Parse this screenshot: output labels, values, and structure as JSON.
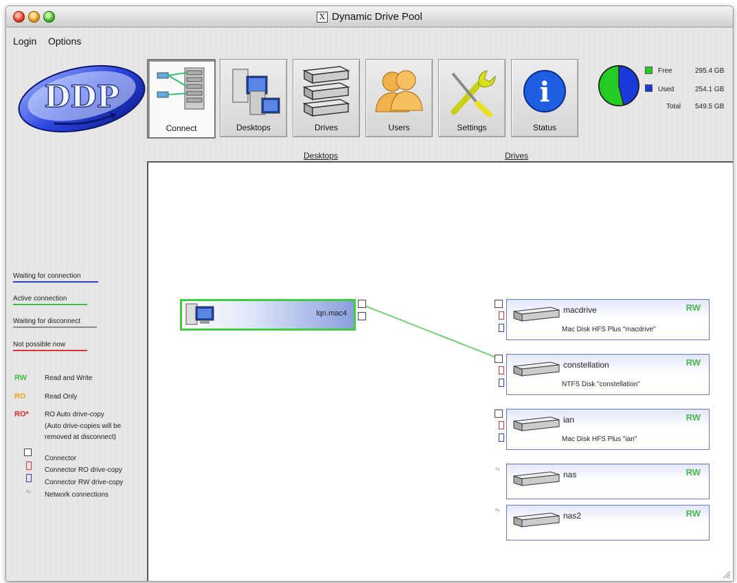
{
  "window": {
    "title": "Dynamic Drive Pool",
    "x_badge": "X"
  },
  "menu": [
    {
      "label": "Login"
    },
    {
      "label": "Options"
    }
  ],
  "logo": {
    "text": "DDP"
  },
  "toolbar": [
    {
      "label": "Connect",
      "active": true
    },
    {
      "label": "Desktops"
    },
    {
      "label": "Drives"
    },
    {
      "label": "Users"
    },
    {
      "label": "Settings"
    },
    {
      "label": "Status"
    }
  ],
  "storage": {
    "free_label": "Free",
    "free_value": "295.4 GB",
    "free_color": "#22cc22",
    "used_label": "Used",
    "used_value": "254.1 GB",
    "used_color": "#1a3adc",
    "total_label": "Total",
    "total_value": "549.5 GB",
    "free_fraction": 0.5376
  },
  "sections": {
    "desktops": "Desktops",
    "drives": "Drives"
  },
  "status_legend": [
    {
      "label": "Waiting for connection",
      "color": "#2a3fd0"
    },
    {
      "label": "Active connection",
      "color": "#39c239"
    },
    {
      "label": "Waiting for disconnect",
      "color": "#777777"
    },
    {
      "label": "Not possible now",
      "color": "#e03030"
    }
  ],
  "access_legend": [
    {
      "tag": "RW",
      "label": "Read and Write",
      "color": "#3fbf3f"
    },
    {
      "tag": "RO",
      "label": "Read Only",
      "color": "#f0a020"
    },
    {
      "tag": "RO*",
      "label": "RO Auto drive-copy",
      "label2": "(Auto drive-copies will be",
      "label3": "removed at disconnect)",
      "color": "#e02020"
    }
  ],
  "connector_legend": [
    {
      "label": "Connector"
    },
    {
      "label": "Connector RO drive-copy"
    },
    {
      "label": "Connector RW drive-copy"
    },
    {
      "label": "Network connections"
    }
  ],
  "desktop": {
    "name": "lqn.mac4"
  },
  "drives": [
    {
      "name": "macdrive",
      "access": "RW",
      "desc": "Mac Disk HFS Plus \"macdrive\""
    },
    {
      "name": "constellation",
      "access": "RW",
      "desc": "NTFS Disk \"constellation\""
    },
    {
      "name": "ian",
      "access": "RW",
      "desc": "Mac Disk HFS Plus \"ian\""
    },
    {
      "name": "nas",
      "access": "RW",
      "desc": ""
    },
    {
      "name": "nas2",
      "access": "RW",
      "desc": ""
    }
  ]
}
